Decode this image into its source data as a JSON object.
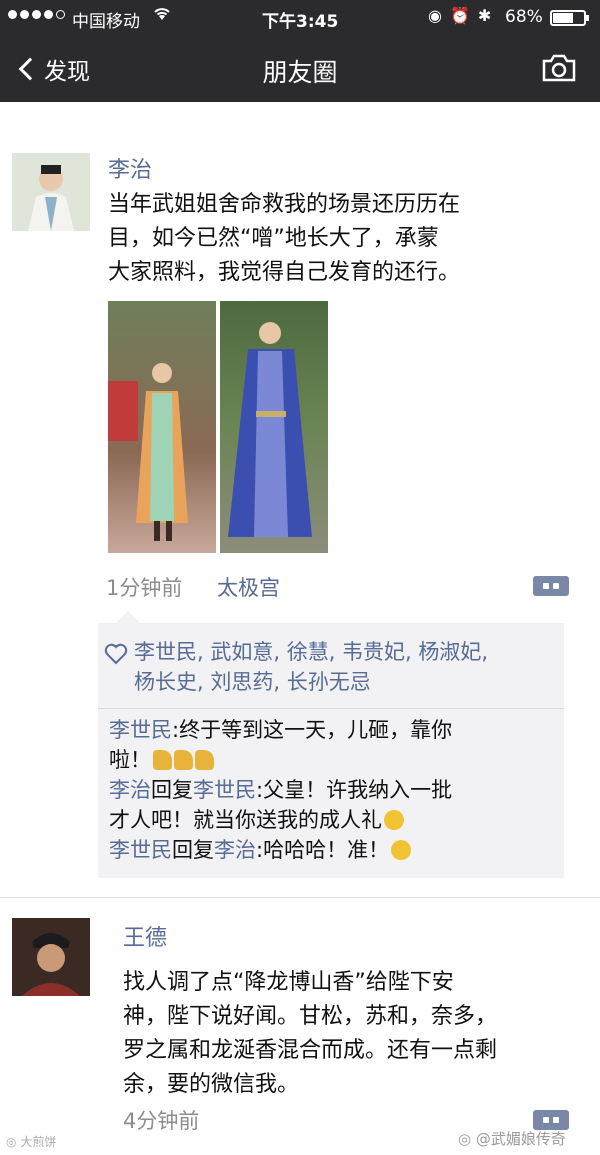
{
  "status_bar": {
    "carrier": "中国移动",
    "time": "下午3:45",
    "battery_text": "68%",
    "battery_level": 0.68,
    "icons": [
      "signal-icon",
      "wifi-icon",
      "lock-rotation-icon",
      "alarm-icon",
      "bluetooth-icon",
      "battery-icon"
    ]
  },
  "nav": {
    "back_label": "发现",
    "title": "朋友圈",
    "camera_icon": "camera-icon"
  },
  "posts": [
    {
      "author": "李治",
      "lines": [
        "当年武姐姐舍命救我的场景还历历在",
        "目，如今已然“噌”地长大了，承蒙",
        "大家照料，我觉得自己发育的还行。"
      ],
      "time": "1分钟前",
      "location": "太极宫",
      "likes": {
        "icon": "heart-icon",
        "line1": "李世民, 武如意, 徐慧, 韦贵妃, 杨淑妃,",
        "line2": "杨长史, 刘思药, 长孙无忌"
      },
      "comments": [
        {
          "user": "李世民",
          "text_line1": ":终于等到这一天，儿砸，靠你",
          "text_line2": "啦！"
        },
        {
          "user": "李治",
          "reply_word": "回复",
          "reply_to": "李世民",
          "text_line1": ":父皇！许我纳入一批",
          "text_line2": "才人吧！就当你送我的成人礼"
        },
        {
          "user": "李世民",
          "reply_word": "回复",
          "reply_to": "李治",
          "text_line1": ":哈哈哈！准！"
        }
      ]
    },
    {
      "author": "王德",
      "lines": [
        "找人调了点“降龙博山香”给陛下安",
        "神，陛下说好闻。甘松，苏和，奈多，",
        "罗之属和龙涎香混合而成。还有一点剩",
        "余，要的微信我。"
      ],
      "time": "4分钟前"
    }
  ],
  "watermarks": {
    "left": "大煎饼",
    "right": "@武媚娘传奇"
  },
  "colors": {
    "bar_bg": "#2b2b2d",
    "link_blue": "#566b95",
    "likes_bg": "#f2f2f4"
  }
}
